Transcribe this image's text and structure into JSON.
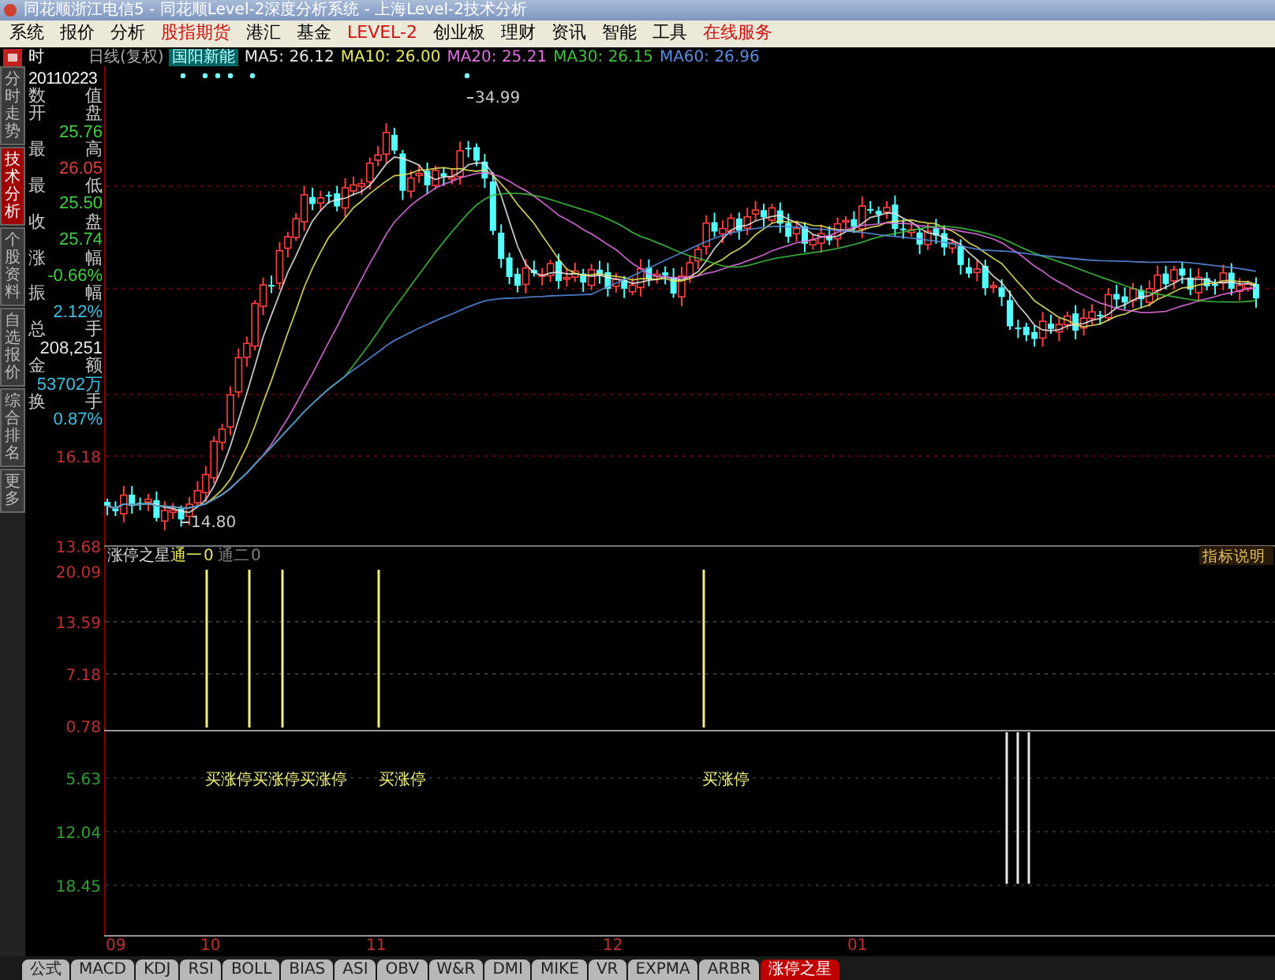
{
  "window": {
    "title": "同花顺浙江电信5 - 同花顺Level-2深度分析系统 - 上海Level-2技术分析"
  },
  "menu": [
    {
      "label": "系统",
      "highlighted": false
    },
    {
      "label": "报价",
      "highlighted": false
    },
    {
      "label": "分析",
      "highlighted": false
    },
    {
      "label": "股指期货",
      "highlighted": true
    },
    {
      "label": "港汇",
      "highlighted": false
    },
    {
      "label": "基金",
      "highlighted": false
    },
    {
      "label": "LEVEL-2",
      "highlighted": true
    },
    {
      "label": "创业板",
      "highlighted": false
    },
    {
      "label": "理财",
      "highlighted": false
    },
    {
      "label": "资讯",
      "highlighted": false
    },
    {
      "label": "智能",
      "highlighted": false
    },
    {
      "label": "工具",
      "highlighted": false
    },
    {
      "label": "在线服务",
      "highlighted": true
    }
  ],
  "chart_header": {
    "period_label": "时",
    "chart_type": "日线(复权)",
    "stock_name": "国阳新能",
    "moving_averages": [
      {
        "label": "MA5: 26.12",
        "color": "#e8e8e8"
      },
      {
        "label": "MA10: 26.00",
        "color": "#e8e860"
      },
      {
        "label": "MA20: 25.21",
        "color": "#e070e0"
      },
      {
        "label": "MA30: 26.15",
        "color": "#40c040"
      },
      {
        "label": "MA60: 26.96",
        "color": "#5a8ce0"
      }
    ]
  },
  "side_tabs": [
    {
      "label": "分时走势",
      "selected": false
    },
    {
      "label": "技术分析",
      "selected": true
    },
    {
      "label": "个股资料",
      "selected": false
    },
    {
      "label": "自选报价",
      "selected": false
    },
    {
      "label": "综合排名",
      "selected": false
    },
    {
      "label": "更多",
      "selected": false
    }
  ],
  "quote_panel": {
    "date": "20110223",
    "header": "数 值",
    "fields": [
      {
        "label": "开 盘",
        "value": "25.76",
        "color": "#40d040"
      },
      {
        "label": "最 高",
        "value": "26.05",
        "color": "#e04040"
      },
      {
        "label": "最 低",
        "value": "25.50",
        "color": "#40d040"
      },
      {
        "label": "收 盘",
        "value": "25.74",
        "color": "#40d040"
      },
      {
        "label": "涨 幅",
        "value": "-0.66%",
        "color": "#40d040"
      },
      {
        "label": "振 幅",
        "value": "2.12%",
        "color": "#40c0e0"
      },
      {
        "label": "总 手",
        "value": "208,251",
        "color": "#e8e8e8"
      },
      {
        "label": "金 额",
        "value": "53702万",
        "color": "#40c0e0"
      },
      {
        "label": "换 手",
        "value": "0.87%",
        "color": "#40c0e0"
      }
    ]
  },
  "price_chart": {
    "axis_labels": [
      {
        "label": "16.18",
        "color": "#c03030"
      },
      {
        "label": "13.68",
        "color": "#c03030"
      }
    ],
    "high_label": "34.99",
    "low_label": "14.80"
  },
  "indicator": {
    "name": "涨停之星",
    "params": [
      {
        "label": "通一",
        "value": "0",
        "color": "#e8e860"
      },
      {
        "label": "通二",
        "value": "0",
        "color": "#808080"
      }
    ],
    "help_button": "指标说明",
    "axis_labels": [
      {
        "label": "20.09",
        "color": "#c03030"
      },
      {
        "label": "13.59",
        "color": "#c03030"
      },
      {
        "label": "7.18",
        "color": "#c03030"
      },
      {
        "label": "0.78",
        "color": "#c03030"
      },
      {
        "label": "5.63",
        "color": "#30a030"
      },
      {
        "label": "12.04",
        "color": "#30a030"
      },
      {
        "label": "18.45",
        "color": "#30a030"
      }
    ],
    "signal_labels": [
      "买涨停买涨停买涨停",
      "买涨停",
      "买涨停"
    ]
  },
  "x_axis": [
    "09",
    "10",
    "11",
    "12",
    "01"
  ],
  "bottom_tabs": [
    {
      "label": "公式",
      "selected": false
    },
    {
      "label": "MACD",
      "selected": false
    },
    {
      "label": "KDJ",
      "selected": false
    },
    {
      "label": "RSI",
      "selected": false
    },
    {
      "label": "BOLL",
      "selected": false
    },
    {
      "label": "BIAS",
      "selected": false
    },
    {
      "label": "ASI",
      "selected": false
    },
    {
      "label": "OBV",
      "selected": false
    },
    {
      "label": "W&R",
      "selected": false
    },
    {
      "label": "DMI",
      "selected": false
    },
    {
      "label": "MIKE",
      "selected": false
    },
    {
      "label": "VR",
      "selected": false
    },
    {
      "label": "EXPMA",
      "selected": false
    },
    {
      "label": "ARBR",
      "selected": false
    },
    {
      "label": "涨停之星",
      "selected": true
    }
  ]
}
